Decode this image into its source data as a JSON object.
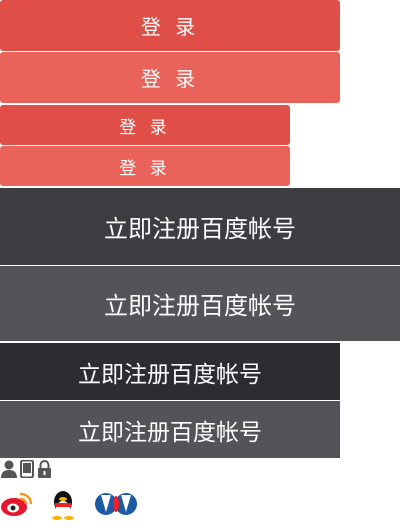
{
  "login_buttons": [
    "登 录",
    "登 录",
    "登 录",
    "登 录"
  ],
  "register_buttons": [
    "立即注册百度帐号",
    "立即注册百度帐号",
    "立即注册百度帐号",
    "立即注册百度帐号"
  ],
  "icons": [
    "user-icon",
    "phone-icon",
    "lock-icon"
  ],
  "social": [
    "weibo-icon",
    "qq-icon",
    "renren-icon"
  ]
}
